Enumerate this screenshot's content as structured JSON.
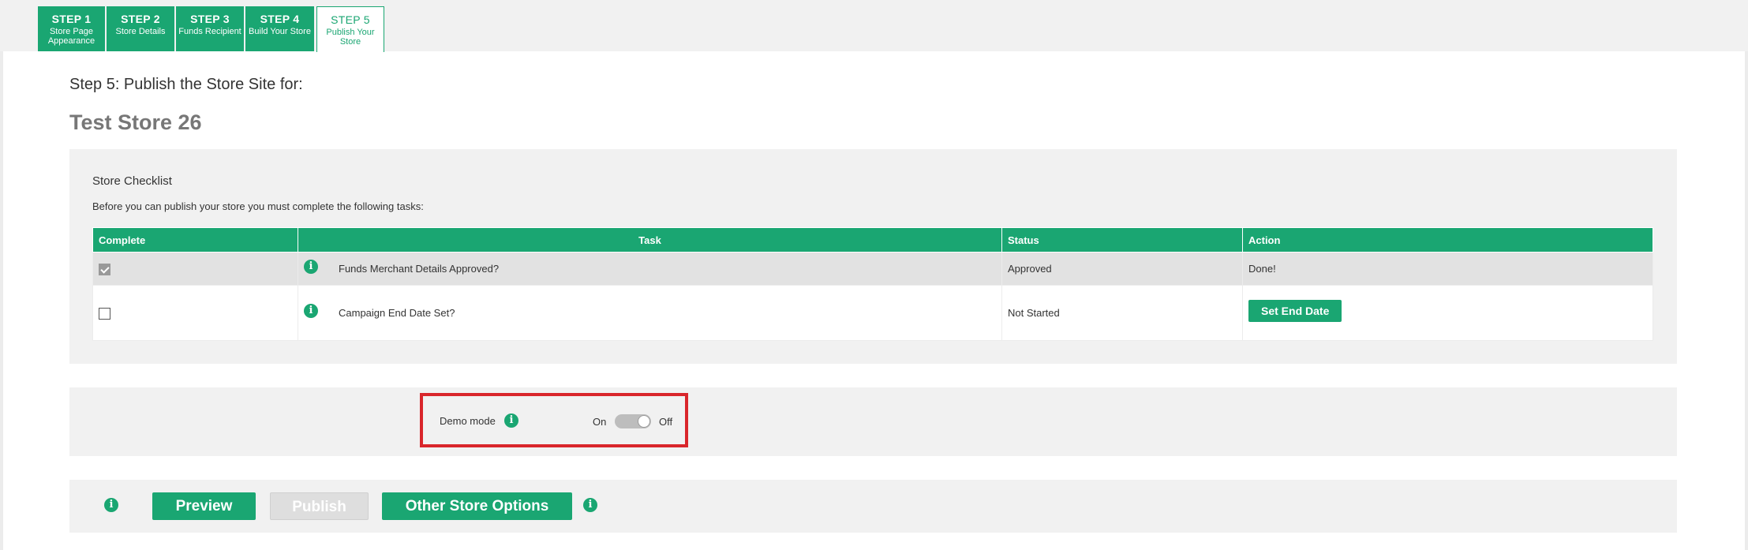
{
  "tabs": [
    {
      "step": "STEP 1",
      "label": "Store Page Appearance",
      "label_lines": [
        "Store Page",
        "Appearance"
      ]
    },
    {
      "step": "STEP 2",
      "label": "Store Details",
      "label_lines": [
        "Store Details"
      ]
    },
    {
      "step": "STEP 3",
      "label": "Funds Recipient",
      "label_lines": [
        "Funds Recipient"
      ]
    },
    {
      "step": "STEP 4",
      "label": "Build Your Store",
      "label_lines": [
        "Build Your Store"
      ]
    },
    {
      "step": "STEP 5",
      "label": "Publish Your Store",
      "label_lines": [
        "Publish Your",
        "Store"
      ],
      "active": true
    }
  ],
  "page": {
    "heading": "Step 5: Publish the Store Site for:",
    "store_name": "Test Store 26"
  },
  "checklist": {
    "title": "Store Checklist",
    "description": "Before you can publish your store you must complete the following tasks:",
    "columns": [
      "Complete",
      "Task",
      "Status",
      "Action"
    ],
    "rows": [
      {
        "complete": true,
        "task": "Funds Merchant Details Approved?",
        "status": "Approved",
        "action": "Done!"
      },
      {
        "complete": false,
        "task": "Campaign End Date Set?",
        "status": "Not Started",
        "action": "Set End Date"
      }
    ]
  },
  "demo_mode": {
    "label": "Demo mode",
    "on_label": "On",
    "off_label": "Off",
    "state": "Off"
  },
  "actions": {
    "preview": "Preview",
    "publish": "Publish",
    "other_options": "Other Store Options"
  },
  "icons": {
    "info": "i"
  },
  "colors": {
    "accent": "#1aa672",
    "panel_bg": "#f1f1f1",
    "highlight_border": "#d9262b",
    "disabled_button": "#dedede"
  }
}
